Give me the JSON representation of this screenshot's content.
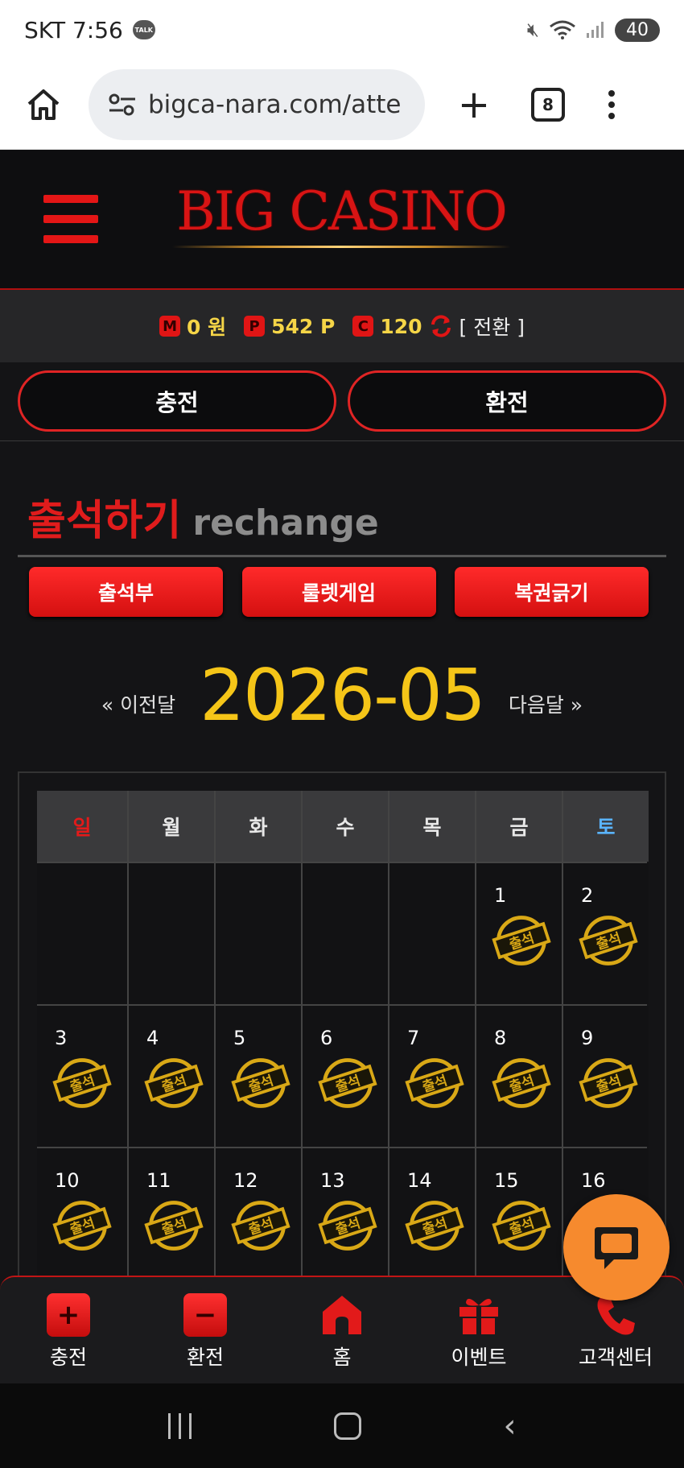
{
  "status_bar": {
    "carrier_time": "SKT 7:56",
    "talk_badge": "TALK",
    "battery": "40"
  },
  "browser": {
    "url": "bigca-nara.com/atte",
    "tab_count": "8"
  },
  "site": {
    "logo": "BIG CASINO"
  },
  "balance": {
    "money_badge": "M",
    "money": "0 원",
    "point_badge": "P",
    "points": "542 P",
    "coin_badge": "C",
    "coins": "120",
    "switch_label": "[ 전환 ]"
  },
  "actions": {
    "charge": "충전",
    "exchange": "환전"
  },
  "section": {
    "title_ko": "출석하기",
    "title_en": "rechange"
  },
  "tabs": [
    {
      "label": "출석부"
    },
    {
      "label": "룰렛게임"
    },
    {
      "label": "복권긁기"
    }
  ],
  "month_nav": {
    "prev": "« 이전달",
    "current": "2026-05",
    "next": "다음달 »"
  },
  "calendar": {
    "weekdays": [
      "일",
      "월",
      "화",
      "수",
      "목",
      "금",
      "토"
    ],
    "stamp_text": "출석",
    "days": [
      "1",
      "2",
      "3",
      "4",
      "5",
      "6",
      "7",
      "8",
      "9",
      "10",
      "11",
      "12",
      "13",
      "14",
      "15",
      "16"
    ],
    "attended": [
      1,
      2,
      3,
      4,
      5,
      6,
      7,
      8,
      9,
      10,
      11,
      12,
      13,
      14,
      15
    ],
    "first_weekday_index": 5
  },
  "bottom_nav": [
    {
      "label": "충전",
      "icon": "plus-square-icon"
    },
    {
      "label": "환전",
      "icon": "minus-square-icon"
    },
    {
      "label": "홈",
      "icon": "home-icon"
    },
    {
      "label": "이벤트",
      "icon": "gift-icon"
    },
    {
      "label": "고객센터",
      "icon": "phone-icon"
    }
  ],
  "colors": {
    "accent_red": "#e01c1c",
    "gold": "#f5c518",
    "chat_orange": "#f68a2e"
  }
}
